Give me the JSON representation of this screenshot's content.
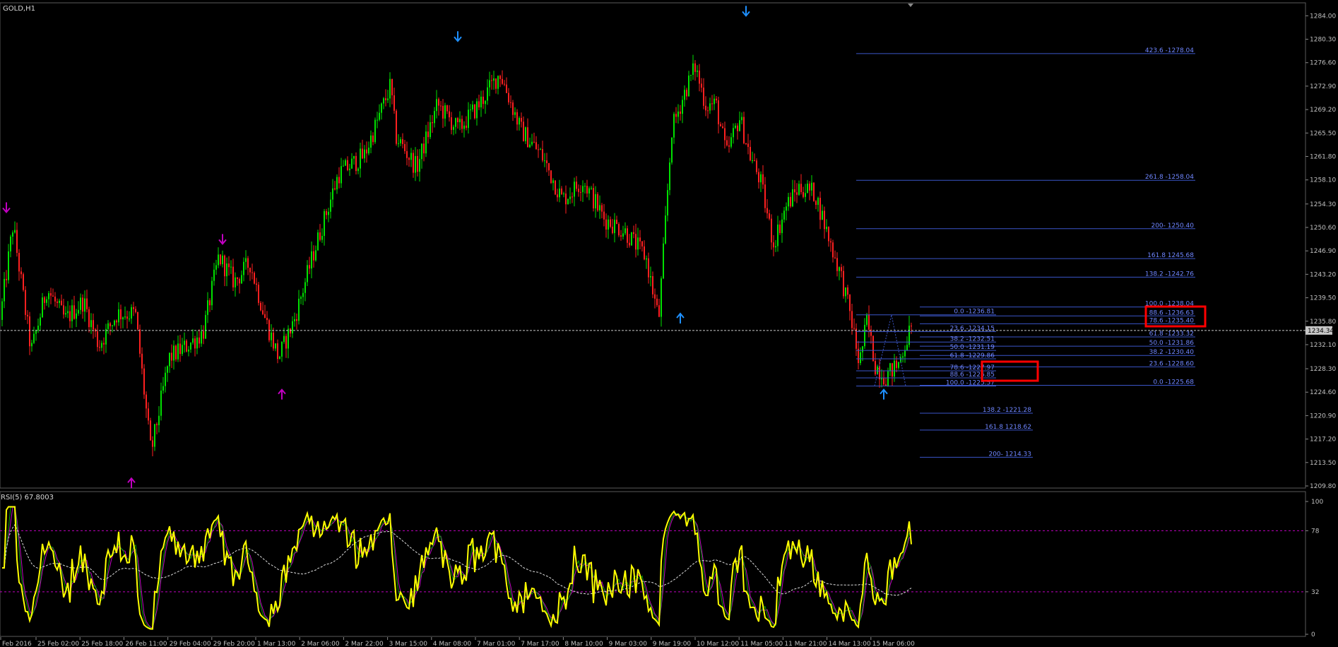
{
  "window_title": "GOLD,H1",
  "indicator_label": "RSI(5) 67.8003",
  "current_price": "1234.34",
  "colors": {
    "background": "#000000",
    "bull": "#00e000",
    "bear": "#ff2020",
    "fib": "#3a55c8",
    "fib_text": "#6f86ff",
    "rsi_main": "#ffff00",
    "rsi_green": "#00a000",
    "rsi_magenta": "#c000c0",
    "arrow_blue": "#1e90ff",
    "arrow_magenta": "#c000c0",
    "highlight_box": "#ff0000",
    "axis_text": "#c0c0c0"
  },
  "chart_data": [
    {
      "type": "candlestick",
      "ylim": [
        1209.8,
        1285.6
      ],
      "price_axis_ticks": [
        "1284.00",
        "1280.30",
        "1276.60",
        "1272.90",
        "1269.20",
        "1265.50",
        "1261.80",
        "1258.10",
        "1254.30",
        "1250.60",
        "1246.90",
        "1243.20",
        "1239.50",
        "1235.80",
        "1232.10",
        "1228.30",
        "1224.60",
        "1220.90",
        "1217.20",
        "1213.50",
        "1209.80"
      ],
      "time_axis_labels": [
        "Feb 2016",
        "25 Feb 02:00",
        "25 Feb 18:00",
        "26 Feb 11:00",
        "29 Feb 04:00",
        "29 Feb 20:00",
        "1 Mar 13:00",
        "2 Mar 06:00",
        "2 Mar 22:00",
        "3 Mar 15:00",
        "4 Mar 08:00",
        "7 Mar 01:00",
        "7 Mar 17:00",
        "8 Mar 10:00",
        "9 Mar 03:00",
        "9 Mar 19:00",
        "10 Mar 12:00",
        "11 Mar 05:00",
        "11 Mar 21:00",
        "14 Mar 13:00",
        "15 Mar 06:00"
      ],
      "price_path": [
        [
          0,
          1236
        ],
        [
          5,
          1251
        ],
        [
          12,
          1231
        ],
        [
          18,
          1241
        ],
        [
          25,
          1236
        ],
        [
          32,
          1239
        ],
        [
          38,
          1232
        ],
        [
          45,
          1237
        ],
        [
          52,
          1237
        ],
        [
          58,
          1215
        ],
        [
          65,
          1230
        ],
        [
          72,
          1232
        ],
        [
          78,
          1234
        ],
        [
          84,
          1246
        ],
        [
          90,
          1242
        ],
        [
          96,
          1245
        ],
        [
          102,
          1236
        ],
        [
          107,
          1230
        ],
        [
          113,
          1236
        ],
        [
          120,
          1246
        ],
        [
          130,
          1259
        ],
        [
          140,
          1262
        ],
        [
          150,
          1273
        ],
        [
          152,
          1265
        ],
        [
          160,
          1260
        ],
        [
          168,
          1270
        ],
        [
          176,
          1266
        ],
        [
          184,
          1270
        ],
        [
          192,
          1275
        ],
        [
          200,
          1266
        ],
        [
          208,
          1262
        ],
        [
          216,
          1255
        ],
        [
          224,
          1258
        ],
        [
          232,
          1252
        ],
        [
          240,
          1250
        ],
        [
          248,
          1246
        ],
        [
          253,
          1236
        ],
        [
          258,
          1266
        ],
        [
          263,
          1272
        ],
        [
          267,
          1276
        ],
        [
          271,
          1270
        ],
        [
          275,
          1270
        ],
        [
          279,
          1262
        ],
        [
          284,
          1268
        ],
        [
          288,
          1262
        ],
        [
          292,
          1258
        ],
        [
          297,
          1248
        ],
        [
          302,
          1254
        ],
        [
          307,
          1257
        ],
        [
          313,
          1256
        ],
        [
          319,
          1248
        ],
        [
          323,
          1243
        ],
        [
          327,
          1236
        ],
        [
          330,
          1229
        ],
        [
          333,
          1236
        ],
        [
          336,
          1229
        ],
        [
          340,
          1227
        ],
        [
          345,
          1229
        ],
        [
          349,
          1234
        ]
      ],
      "arrows": [
        {
          "type": "down",
          "candle": 2,
          "price": 1253,
          "color": "magenta"
        },
        {
          "type": "up",
          "candle": 61,
          "price": 1211,
          "color": "magenta"
        },
        {
          "type": "down",
          "candle": 104,
          "price": 1248,
          "color": "magenta"
        },
        {
          "type": "up",
          "candle": 132,
          "price": 1225,
          "color": "magenta"
        },
        {
          "type": "down",
          "candle": 215,
          "price": 1280,
          "color": "blue"
        },
        {
          "type": "up",
          "candle": 320,
          "price": 1237,
          "color": "blue"
        },
        {
          "type": "down",
          "candle": 351,
          "price": 1284,
          "color": "blue"
        },
        {
          "type": "up",
          "candle": 416,
          "price": 1225,
          "color": "blue"
        }
      ],
      "fib_sets": [
        {
          "name": "extension",
          "label_align": "right",
          "levels": [
            {
              "price": 1278.04,
              "label": "423.6 -1278.04"
            },
            {
              "price": 1258.04,
              "label": "261.8 -1258.04"
            },
            {
              "price": 1250.4,
              "label": "200- 1250.40"
            },
            {
              "price": 1245.68,
              "label": "161.8 1245.68"
            },
            {
              "price": 1242.76,
              "label": "138.2 -1242.76"
            },
            {
              "price": 1238.04,
              "label": "100.0 -1238.04"
            },
            {
              "price": 1236.63,
              "label": "88.6 -1236.63"
            },
            {
              "price": 1235.4,
              "label": "78.6 -1235.40"
            },
            {
              "price": 1233.32,
              "label": "61.8 -1233.32"
            },
            {
              "price": 1231.86,
              "label": "50.0 -1231.86"
            },
            {
              "price": 1230.4,
              "label": "38.2 -1230.40"
            },
            {
              "price": 1228.6,
              "label": "23.6 -1228.60"
            },
            {
              "price": 1225.68,
              "label": "0.0 -1225.68"
            }
          ]
        },
        {
          "name": "retracement",
          "label_align": "right",
          "levels": [
            {
              "price": 1236.81,
              "label": "0.0 -1236.81"
            },
            {
              "price": 1234.15,
              "label": "23.6 -1234.15"
            },
            {
              "price": 1232.51,
              "label": "38.2 -1232.51"
            },
            {
              "price": 1231.19,
              "label": "50.0 -1231.19"
            },
            {
              "price": 1229.86,
              "label": "61.8 -1229.86"
            },
            {
              "price": 1227.97,
              "label": "78.6 -1227.97"
            },
            {
              "price": 1226.85,
              "label": "88.6 -1226.85"
            },
            {
              "price": 1225.57,
              "label": "100.0 -1225.57"
            },
            {
              "price": 1221.28,
              "label": "138.2 -1221.28"
            },
            {
              "price": 1218.62,
              "label": "161.8 1218.62"
            },
            {
              "price": 1214.33,
              "label": "200- 1214.33"
            }
          ]
        }
      ]
    },
    {
      "type": "line",
      "name": "RSI(5)",
      "ylim": [
        0,
        100
      ],
      "axis_ticks": [
        "100",
        "78",
        "32",
        "0"
      ],
      "levels": [
        78,
        32
      ],
      "last_value": 67.8003
    }
  ]
}
